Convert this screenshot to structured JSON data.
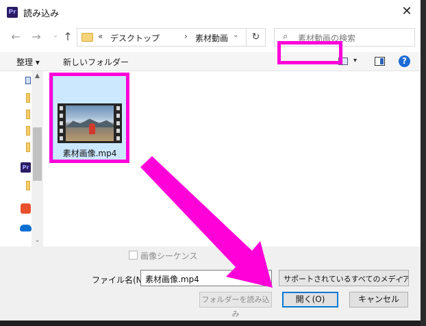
{
  "window": {
    "title": "読み込み",
    "app_badge": "Pr",
    "close_glyph": "✕"
  },
  "nav": {
    "back_glyph": "←",
    "forward_glyph": "→",
    "history_glyph": "⌄",
    "up_glyph": "↑",
    "path_overflow": "«",
    "crumbs": [
      "デスクトップ",
      "素材動画"
    ],
    "separator": "›",
    "dropdown_glyph": "⌄",
    "refresh_glyph": "↻",
    "search_placeholder": "素材動画の検索",
    "search_glyph": "⌕"
  },
  "toolbar": {
    "organize_label": "整理 ▾",
    "new_folder_label": "新しいフォルダー",
    "view_dropdown_glyph": "▾",
    "help_glyph": "?"
  },
  "scrollbar": {
    "up_glyph": "▲",
    "down_glyph": "⌄"
  },
  "files": [
    {
      "name": "素材画像.mp4",
      "type": "video"
    }
  ],
  "footer": {
    "image_sequence_label": "画像シーケンス",
    "image_sequence_checked": false,
    "filename_label": "ファイル名(N):",
    "filename_value": "素材画像.mp4",
    "filename_dropdown_glyph": "⌄",
    "filetype_value": "サポートされているすべてのメディア ('",
    "filetype_dropdown_glyph": "⌄",
    "import_folder_label": "フォルダーを読み込み",
    "open_label": "開く(O)",
    "cancel_label": "キャンセル"
  },
  "colors": {
    "annotation": "#ff00d8",
    "selection": "#cce8ff",
    "accent": "#0078d7"
  },
  "icons": {
    "app": "premiere-pro-icon",
    "folder": "folder-icon",
    "search": "search-icon",
    "help": "help-icon",
    "preview_pane": "preview-pane-icon",
    "view": "view-mode-icon",
    "onedrive": "onedrive-icon",
    "creative_cloud": "creative-cloud-icon"
  }
}
